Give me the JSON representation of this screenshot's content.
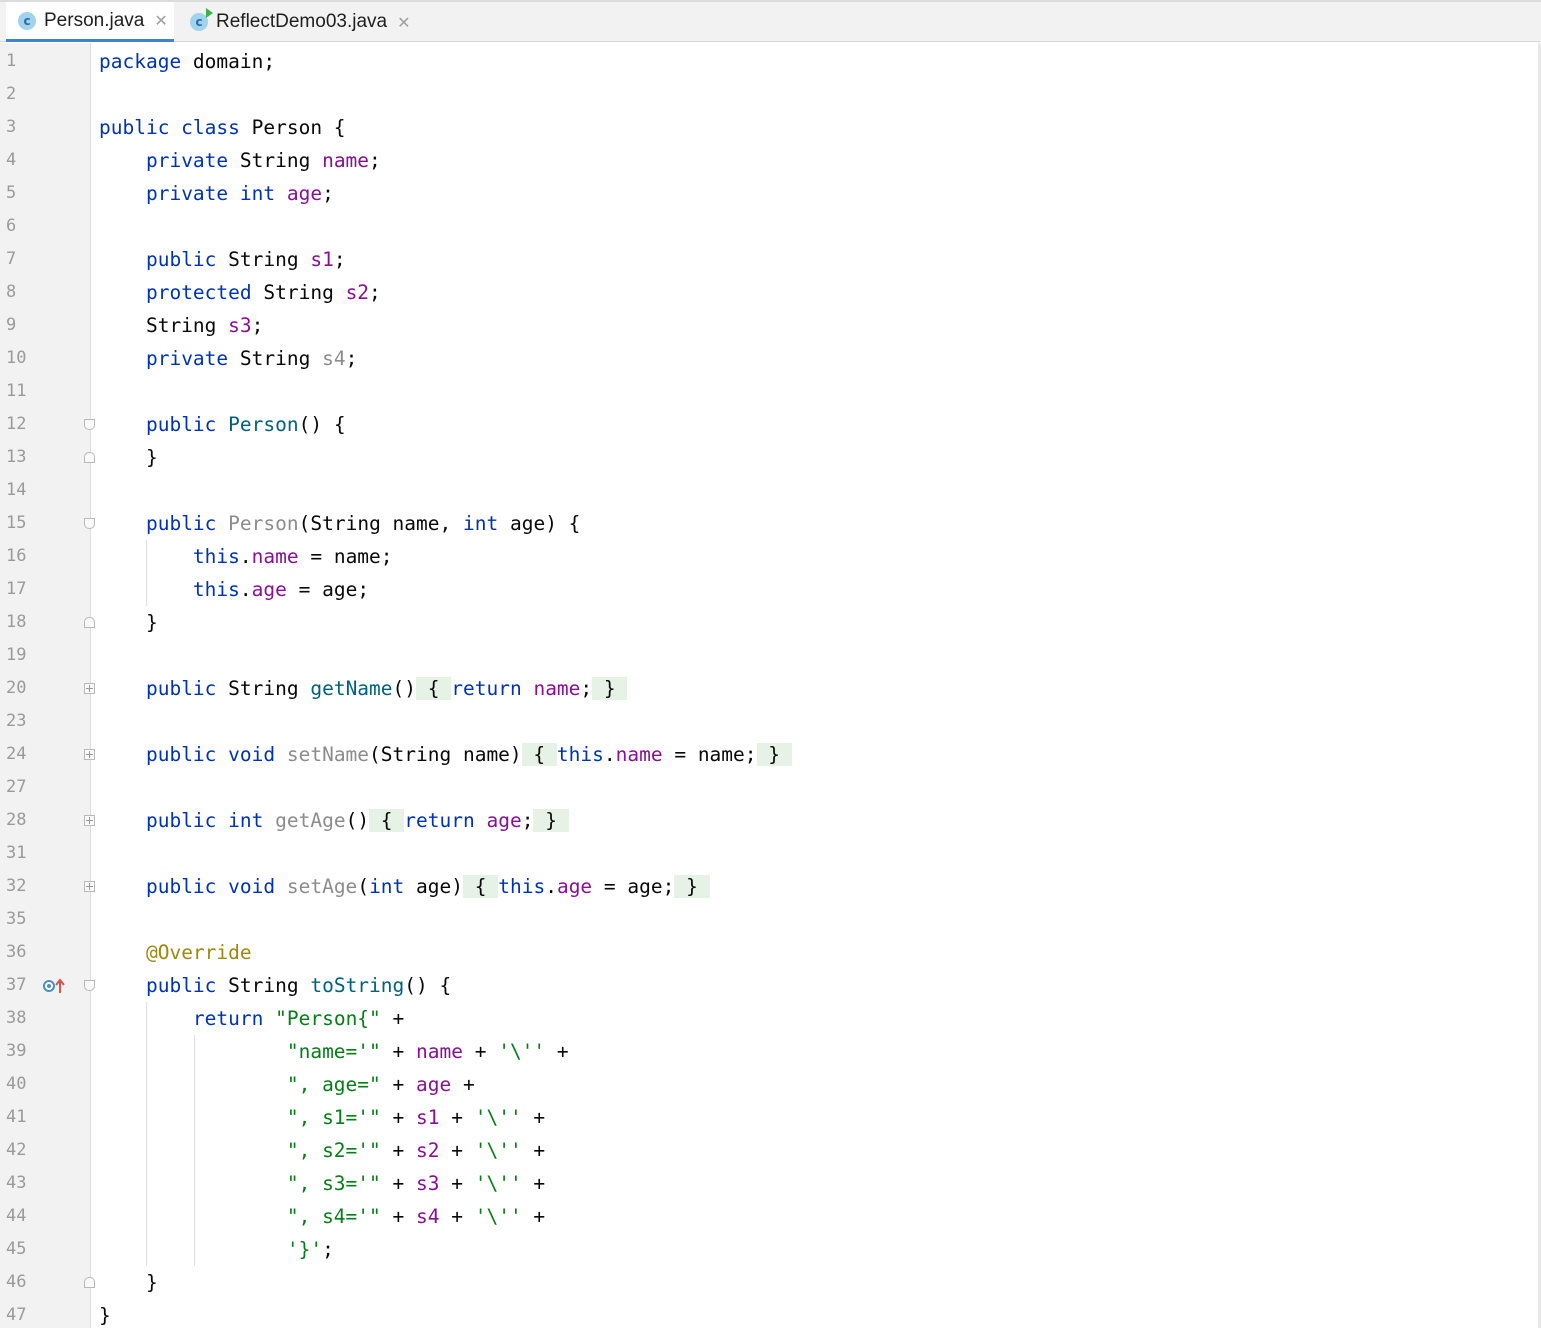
{
  "tabs": [
    {
      "label": "Person.java",
      "icon": "c",
      "active": true
    },
    {
      "label": "ReflectDemo03.java",
      "icon": "c",
      "active": false
    }
  ],
  "colors": {
    "keyword": "#0033b3",
    "field": "#871094",
    "method": "#00627a",
    "string": "#067d17",
    "annotation": "#9e880d"
  },
  "lines": [
    {
      "n": "1",
      "html": "<span class=\"kw\">package</span> domain;"
    },
    {
      "n": "2",
      "html": ""
    },
    {
      "n": "3",
      "html": "<span class=\"kw\">public class</span> Person {"
    },
    {
      "n": "4",
      "html": "    <span class=\"kw\">private</span> String <span class=\"fld\">name</span>;"
    },
    {
      "n": "5",
      "html": "    <span class=\"kw\">private int</span> <span class=\"fld\">age</span>;"
    },
    {
      "n": "6",
      "html": ""
    },
    {
      "n": "7",
      "html": "    <span class=\"kw\">public</span> String <span class=\"fld\">s1</span>;"
    },
    {
      "n": "8",
      "html": "    <span class=\"kw\">protected</span> String <span class=\"fld\">s2</span>;"
    },
    {
      "n": "9",
      "html": "    String <span class=\"fld\">s3</span>;"
    },
    {
      "n": "10",
      "html": "    <span class=\"kw\">private</span> String <span class=\"unused\">s4</span>;"
    },
    {
      "n": "11",
      "html": ""
    },
    {
      "n": "12",
      "html": "    <span class=\"kw\">public</span> <span class=\"fn\">Person</span>() {",
      "fold": "open"
    },
    {
      "n": "13",
      "html": "    }",
      "fold": "close"
    },
    {
      "n": "14",
      "html": ""
    },
    {
      "n": "15",
      "html": "    <span class=\"kw\">public</span> <span class=\"unused\">Person</span>(String name, <span class=\"kw\">int</span> age) {",
      "fold": "open"
    },
    {
      "n": "16",
      "html": "        <span class=\"kw\">this</span>.<span class=\"fld\">name</span> = name;"
    },
    {
      "n": "17",
      "html": "        <span class=\"kw\">this</span>.<span class=\"fld\">age</span> = age;"
    },
    {
      "n": "18",
      "html": "    }",
      "fold": "close"
    },
    {
      "n": "19",
      "html": ""
    },
    {
      "n": "20",
      "html": "    <span class=\"kw\">public</span> String <span class=\"fn\">getName</span>()<span class=\"hl\"> { </span><span class=\"kw\">return</span> <span class=\"fld\">name</span>;<span class=\"hl\"> } </span>",
      "fold": "plus"
    },
    {
      "n": "23",
      "html": ""
    },
    {
      "n": "24",
      "html": "    <span class=\"kw\">public void</span> <span class=\"unused\">setName</span>(String name)<span class=\"hl\"> { </span><span class=\"kw\">this</span>.<span class=\"fld\">name</span> = name;<span class=\"hl\"> } </span>",
      "fold": "plus"
    },
    {
      "n": "27",
      "html": ""
    },
    {
      "n": "28",
      "html": "    <span class=\"kw\">public int</span> <span class=\"unused\">getAge</span>()<span class=\"hl\"> { </span><span class=\"kw\">return</span> <span class=\"fld\">age</span>;<span class=\"hl\"> } </span>",
      "fold": "plus"
    },
    {
      "n": "31",
      "html": ""
    },
    {
      "n": "32",
      "html": "    <span class=\"kw\">public void</span> <span class=\"unused\">setAge</span>(<span class=\"kw\">int</span> age)<span class=\"hl\"> { </span><span class=\"kw\">this</span>.<span class=\"fld\">age</span> = age;<span class=\"hl\"> } </span>",
      "fold": "plus"
    },
    {
      "n": "35",
      "html": ""
    },
    {
      "n": "36",
      "html": "    <span class=\"ann\">@Override</span>"
    },
    {
      "n": "37",
      "html": "    <span class=\"kw\">public</span> String <span class=\"fn\">toString</span>() {",
      "fold": "open",
      "marker": true
    },
    {
      "n": "38",
      "html": "        <span class=\"kw\">return</span> <span class=\"str\">\"Person{\"</span> +"
    },
    {
      "n": "39",
      "html": "                <span class=\"str\">\"name='\"</span> + <span class=\"fld\">name</span> + <span class=\"str\">'\\''</span> +"
    },
    {
      "n": "40",
      "html": "                <span class=\"str\">\", age=\"</span> + <span class=\"fld\">age</span> +"
    },
    {
      "n": "41",
      "html": "                <span class=\"str\">\", s1='\"</span> + <span class=\"fld\">s1</span> + <span class=\"str\">'\\''</span> +"
    },
    {
      "n": "42",
      "html": "                <span class=\"str\">\", s2='\"</span> + <span class=\"fld\">s2</span> + <span class=\"str\">'\\''</span> +"
    },
    {
      "n": "43",
      "html": "                <span class=\"str\">\", s3='\"</span> + <span class=\"fld\">s3</span> + <span class=\"str\">'\\''</span> +"
    },
    {
      "n": "44",
      "html": "                <span class=\"str\">\", s4='\"</span> + <span class=\"fld\">s4</span> + <span class=\"str\">'\\''</span> +"
    },
    {
      "n": "45",
      "html": "                <span class=\"str\">'}'</span>;"
    },
    {
      "n": "46",
      "html": "    }",
      "fold": "close"
    },
    {
      "n": "47",
      "html": "}"
    }
  ]
}
